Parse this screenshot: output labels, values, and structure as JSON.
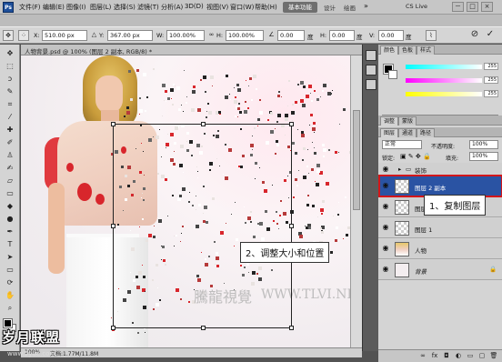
{
  "app": {
    "logo": "Ps",
    "menus": [
      "文件(F)",
      "编辑(E)",
      "图像(I)",
      "图层(L)",
      "选择(S)",
      "滤镜(T)",
      "分析(A)",
      "3D(D)",
      "视图(V)",
      "窗口(W)",
      "帮助(H)"
    ],
    "workspace_button": "基本功能",
    "workspace_links": [
      "设计",
      "绘画"
    ],
    "cs_live": "CS Live",
    "window_controls": [
      "－",
      "□",
      "×"
    ]
  },
  "options": {
    "x_label": "X:",
    "x_value": "510.00 px",
    "y_label": "Y:",
    "y_value": "367.00 px",
    "w_label": "W:",
    "w_value": "100.00%",
    "h_label": "H:",
    "h_value": "100.00%",
    "angle_value": "0.00",
    "angle_unit": "度",
    "h_skew_label": "H:",
    "h_skew_value": "0.00",
    "h_skew_unit": "度",
    "v_skew_label": "V:",
    "v_skew_value": "0.00",
    "v_skew_unit": "度",
    "cancel_icon": "⊘",
    "commit_icon": "✓"
  },
  "document": {
    "tab_title": "人物背景.psd @ 100% (图层 2 副本, RGB/8) *",
    "zoom": "100%",
    "doc_size": "文档:1.77M/11.8M"
  },
  "annotations": {
    "step2": "2、调整大小和位置",
    "step1": "1、复制图层",
    "watermark_cn": "騰龍視覺",
    "watermark_en": "WWW.TLVI.NET",
    "brand": "岁月联盟",
    "brand_url": "www.5yue.com"
  },
  "panels": {
    "color_tabs": [
      "颜色",
      "色板",
      "样式"
    ],
    "color_values": [
      "255",
      "255",
      "255"
    ],
    "adjust_tabs": [
      "调整",
      "蒙版"
    ],
    "layers_tabs": [
      "图层",
      "通道",
      "路径"
    ],
    "blend_mode": "正常",
    "opacity_label": "不透明度:",
    "opacity_value": "100%",
    "lock_label": "锁定:",
    "fill_label": "填充:",
    "fill_value": "100%",
    "layers": [
      {
        "name": "装饰",
        "type": "group"
      },
      {
        "name": "图层 2 副本",
        "selected": true
      },
      {
        "name": "图层 2"
      },
      {
        "name": "图层 1"
      },
      {
        "name": "人物"
      },
      {
        "name": "背景"
      }
    ],
    "footer_icons": [
      "link-icon",
      "fx-icon",
      "mask-icon",
      "adjustment-icon",
      "folder-icon",
      "new-layer-icon",
      "trash-icon"
    ]
  },
  "colors": {
    "accent": "#2a53a3",
    "highlight": "#d3161a",
    "ui_gray": "#d4d4d4"
  }
}
